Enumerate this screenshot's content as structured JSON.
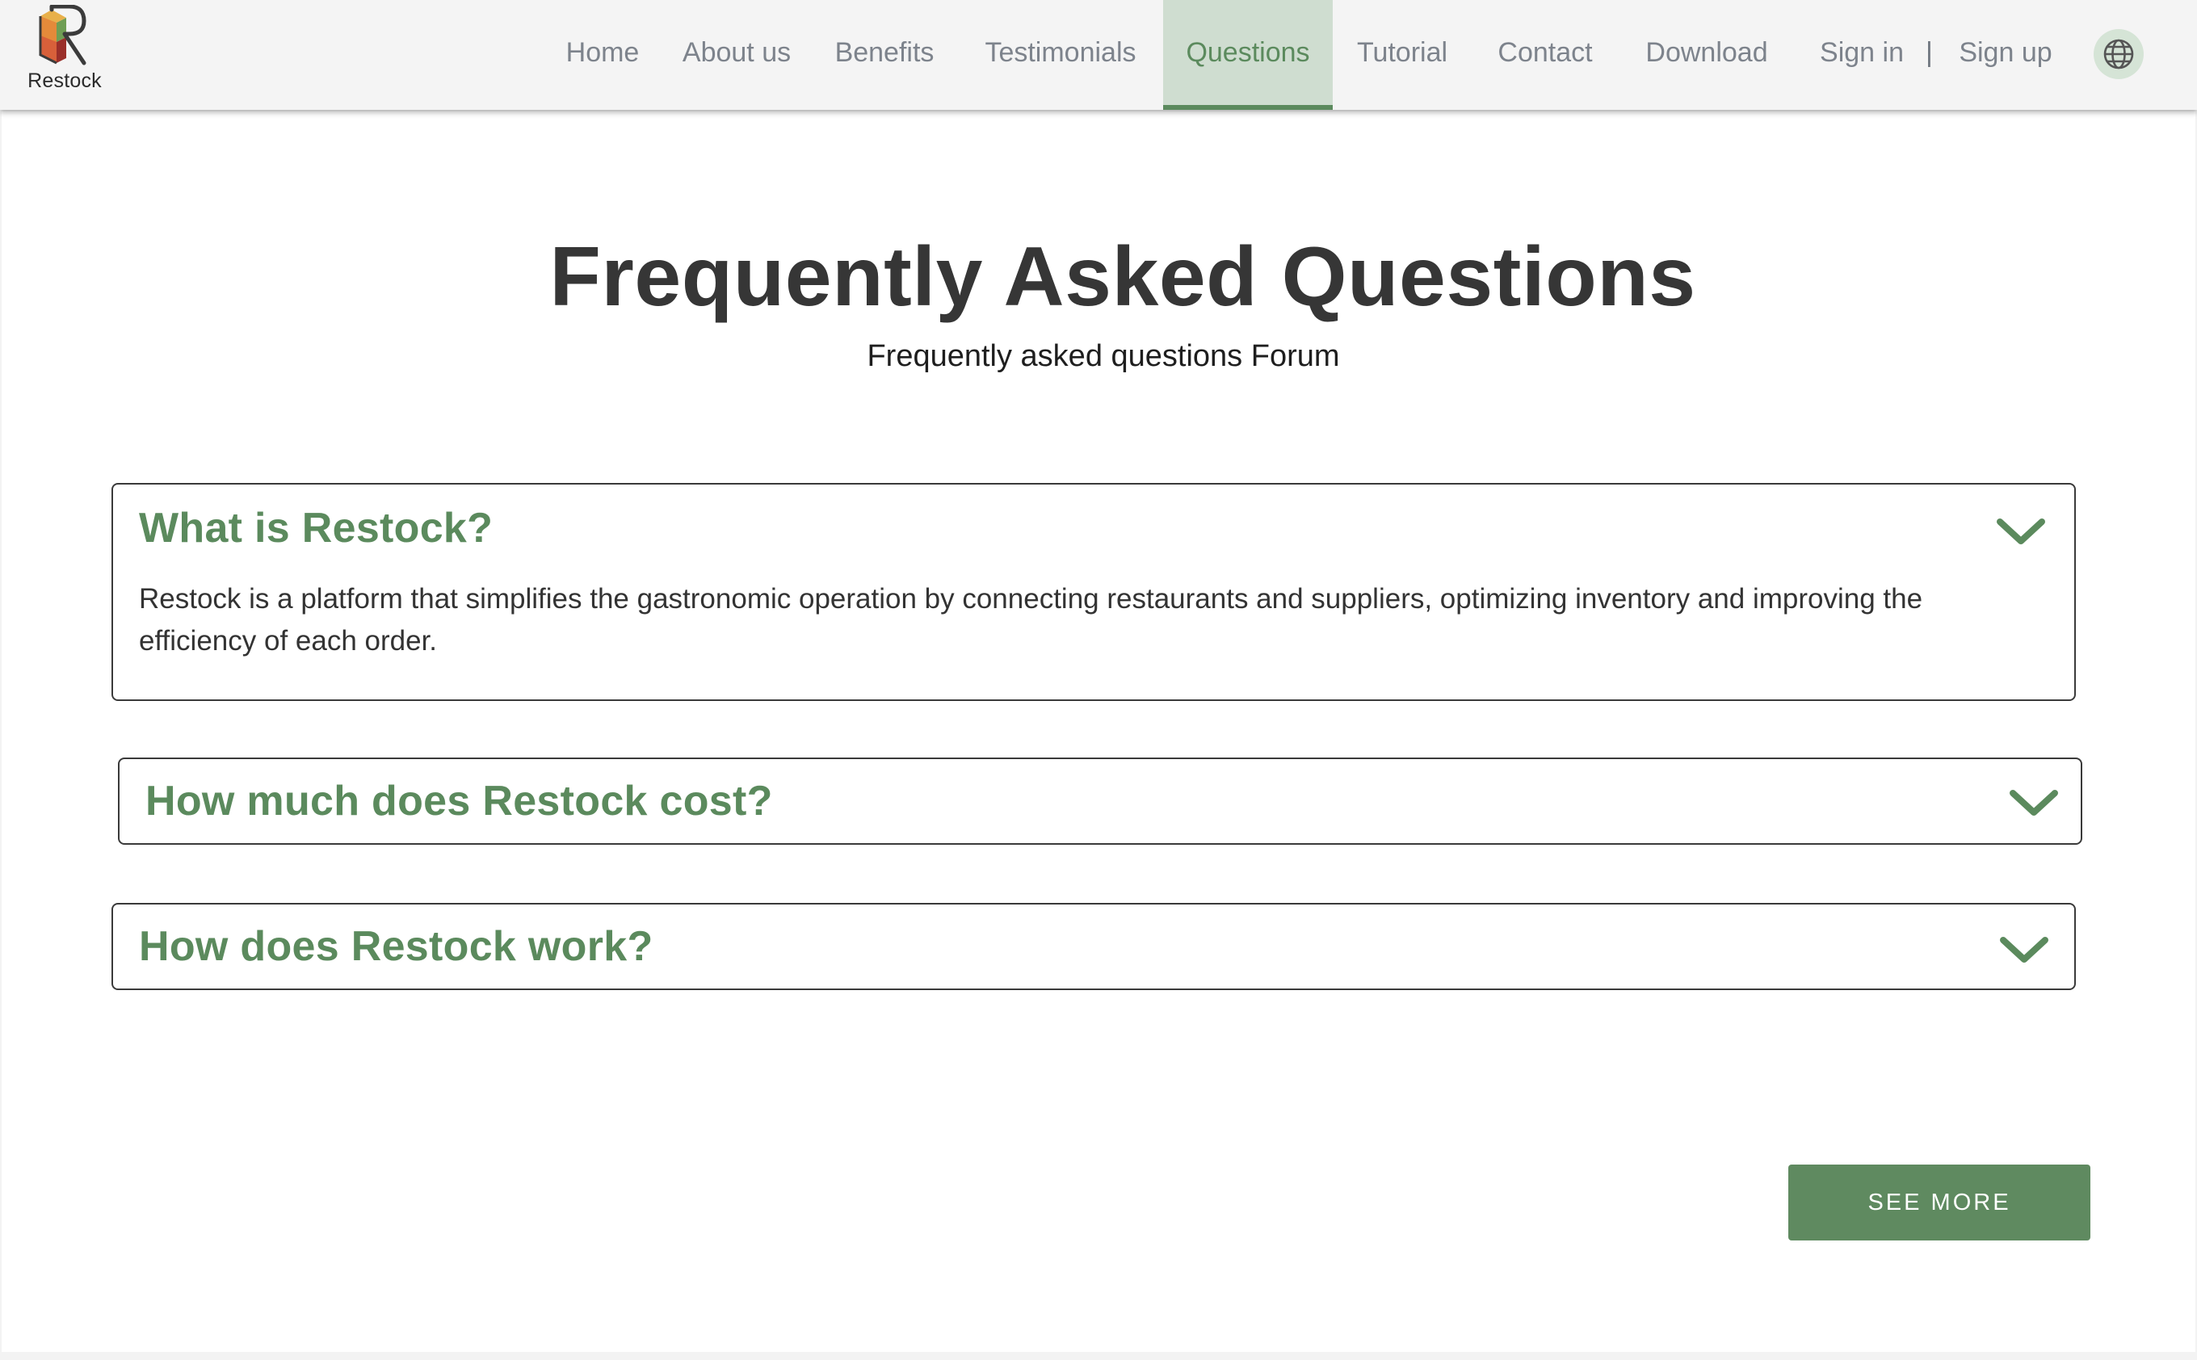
{
  "brand": {
    "name": "Restock",
    "logo_icon": "restock-box-r-logo"
  },
  "nav": {
    "items": [
      {
        "label": "Home",
        "active": false
      },
      {
        "label": "About us",
        "active": false
      },
      {
        "label": "Benefits",
        "active": false
      },
      {
        "label": "Testimonials",
        "active": false
      },
      {
        "label": "Questions",
        "active": true
      },
      {
        "label": "Tutorial",
        "active": false
      },
      {
        "label": "Contact",
        "active": false
      },
      {
        "label": "Download",
        "active": false
      }
    ],
    "sign_in": "Sign in",
    "separator": "|",
    "sign_up": "Sign up",
    "language_icon": "globe-icon"
  },
  "faq_section": {
    "title": "Frequently Asked Questions",
    "subtitle": "Frequently asked questions Forum",
    "items": [
      {
        "question": "What is Restock?",
        "answer": "Restock is a platform that simplifies the gastronomic operation by connecting restaurants and suppliers, optimizing inventory and improving the efficiency of each order.",
        "expanded": true
      },
      {
        "question": "How much does Restock cost?",
        "expanded": false
      },
      {
        "question": "How does Restock work?",
        "expanded": false
      }
    ],
    "see_more_label": "SEE MORE"
  },
  "colors": {
    "accent": "#5b8a5d",
    "active_tab_bg": "#cfddd0",
    "title": "#363636",
    "nav_text": "#7d838c"
  }
}
